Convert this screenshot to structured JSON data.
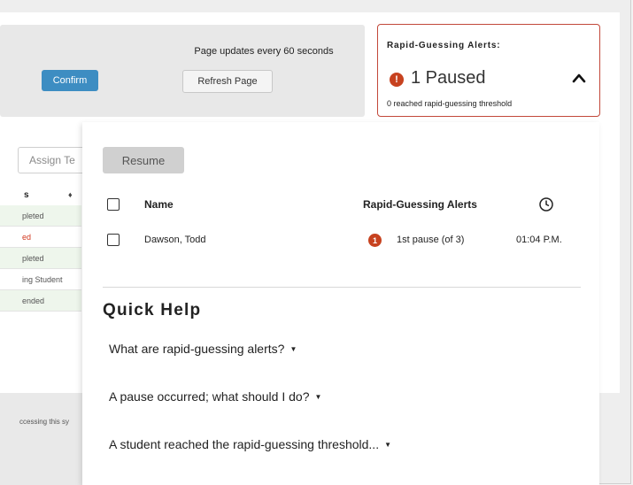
{
  "header": {
    "confirm_label": "Confirm",
    "updates_text": "Page updates every 60 seconds",
    "refresh_label": "Refresh Page"
  },
  "alerts_card": {
    "title": "Rapid-Guessing Alerts:",
    "alert_icon_text": "!",
    "paused_text": "1 Paused",
    "threshold_text": "0 reached rapid-guessing threshold",
    "toggle_icon": "chevron-up-icon"
  },
  "left_table": {
    "assign_label": "Assign Te",
    "column_header": "s",
    "sort_icon": "sort-icon",
    "rows": [
      {
        "text": "pleted",
        "color": "#555555",
        "bg": "#eef6ec"
      },
      {
        "text": "ed",
        "color": "#d2371e",
        "bg": "#ffffff"
      },
      {
        "text": "pleted",
        "color": "#555555",
        "bg": "#eef6ec"
      },
      {
        "text": "ing Student",
        "color": "#555555",
        "bg": "#ffffff"
      },
      {
        "text": "ended",
        "color": "#555555",
        "bg": "#eef6ec"
      }
    ],
    "footer_text": "ccessing this sy"
  },
  "panel": {
    "resume_label": "Resume",
    "columns": {
      "name": "Name",
      "alerts": "Rapid-Guessing Alerts",
      "time_icon": "clock-icon"
    },
    "students": [
      {
        "name": "Dawson, Todd",
        "alert_badge": "1",
        "alert_text": "1st pause (of 3)",
        "time": "01:04 P.M."
      }
    ],
    "quick_help": {
      "title": "Quick Help",
      "items": [
        "What are rapid-guessing alerts?",
        "A pause occurred; what should I do?",
        "A student reached the rapid-guessing threshold..."
      ]
    }
  },
  "colors": {
    "accent_blue": "#3d8dc2",
    "alert_red": "#c7421f",
    "card_border": "#c2483a"
  }
}
